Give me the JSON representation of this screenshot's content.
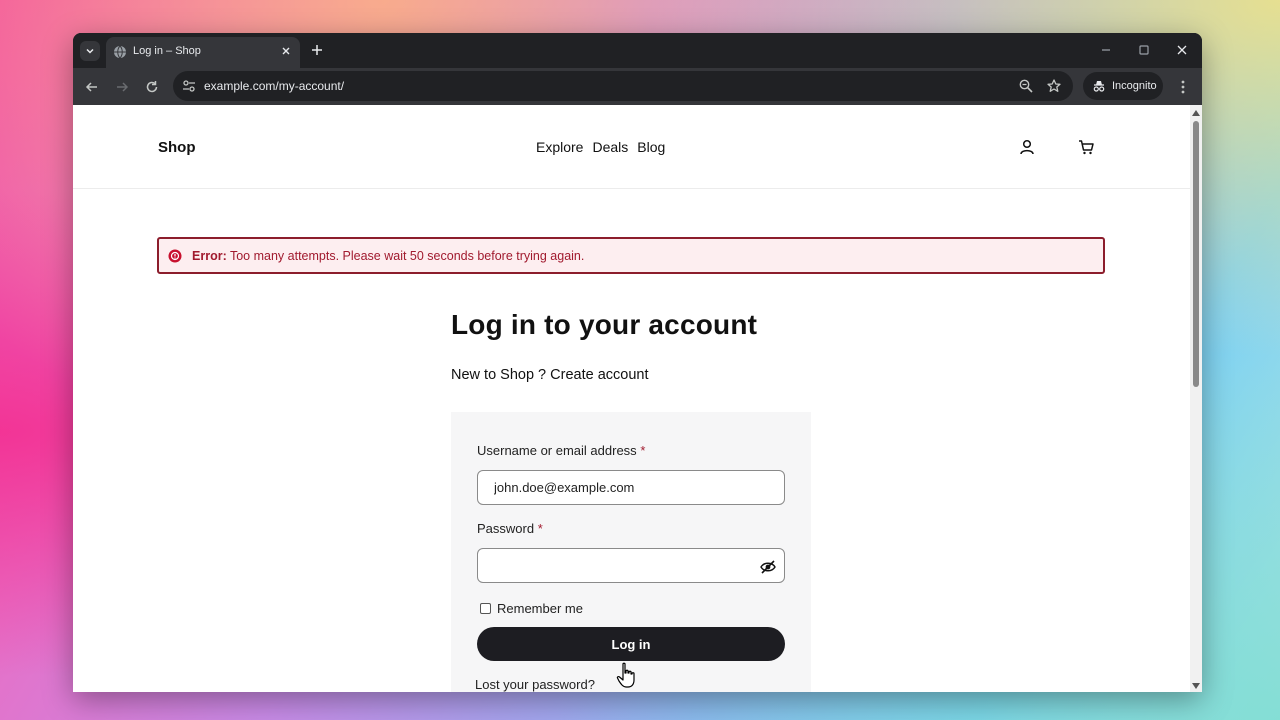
{
  "browser": {
    "tab_title": "Log in – Shop",
    "url": "example.com/my-account/",
    "incognito_label": "Incognito"
  },
  "site": {
    "logo": "Shop",
    "nav": [
      "Explore",
      "Deals",
      "Blog"
    ]
  },
  "error": {
    "prefix": "Error:",
    "message": " Too many attempts. Please wait 50 seconds before trying again."
  },
  "login": {
    "title": "Log in to your account",
    "new_prefix": "New to Shop ? ",
    "create_account": "Create account",
    "username_label": "Username or email address",
    "username_value": "john.doe@example.com",
    "password_label": "Password",
    "password_value": "",
    "required_mark": "*",
    "remember_label": "Remember me",
    "remember_checked": false,
    "submit_label": "Log in",
    "lost_password": "Lost your password?"
  },
  "colors": {
    "error_border": "#8c1d2c",
    "error_bg": "#fdeef0",
    "error_text": "#a11a2e",
    "button_bg": "#1d1d22"
  },
  "icons": [
    "tab-search-icon",
    "globe-icon",
    "close-icon",
    "plus-icon",
    "minimize-icon",
    "maximize-icon",
    "back-icon",
    "forward-icon",
    "reload-icon",
    "site-info-icon",
    "zoom-icon",
    "star-icon",
    "incognito-icon",
    "more-icon",
    "account-icon",
    "cart-icon",
    "error-icon",
    "eye-off-icon",
    "cursor-icon"
  ]
}
